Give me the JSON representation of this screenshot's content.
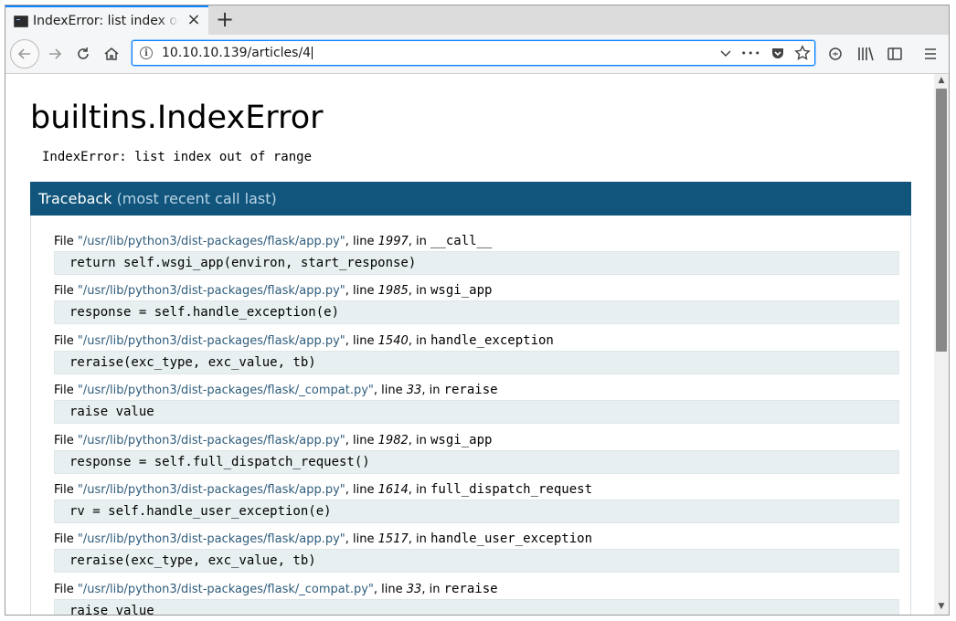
{
  "browser": {
    "tab_title": "IndexError: list index out of range",
    "new_tab_label": "+",
    "close_label": "×",
    "url": "10.10.10.139/articles/4",
    "url_info_label": "i",
    "more_label": "•••"
  },
  "page": {
    "error_heading": "builtins.IndexError",
    "error_message": "IndexError: list index out of range",
    "traceback_title": "Traceback",
    "traceback_subtitle": "(most recent call last)",
    "frames": [
      {
        "prefix": "File ",
        "file": "\"/usr/lib/python3/dist-packages/flask/app.py\"",
        "line_label": ", line ",
        "line": "1997",
        "in_label": ", in ",
        "func": "__call__",
        "code": "return self.wsgi_app(environ, start_response)"
      },
      {
        "prefix": "File ",
        "file": "\"/usr/lib/python3/dist-packages/flask/app.py\"",
        "line_label": ", line ",
        "line": "1985",
        "in_label": ", in ",
        "func": "wsgi_app",
        "code": "response = self.handle_exception(e)"
      },
      {
        "prefix": "File ",
        "file": "\"/usr/lib/python3/dist-packages/flask/app.py\"",
        "line_label": ", line ",
        "line": "1540",
        "in_label": ", in ",
        "func": "handle_exception",
        "code": "reraise(exc_type, exc_value, tb)"
      },
      {
        "prefix": "File ",
        "file": "\"/usr/lib/python3/dist-packages/flask/_compat.py\"",
        "line_label": ", line ",
        "line": "33",
        "in_label": ", in ",
        "func": "reraise",
        "code": "raise value"
      },
      {
        "prefix": "File ",
        "file": "\"/usr/lib/python3/dist-packages/flask/app.py\"",
        "line_label": ", line ",
        "line": "1982",
        "in_label": ", in ",
        "func": "wsgi_app",
        "code": "response = self.full_dispatch_request()"
      },
      {
        "prefix": "File ",
        "file": "\"/usr/lib/python3/dist-packages/flask/app.py\"",
        "line_label": ", line ",
        "line": "1614",
        "in_label": ", in ",
        "func": "full_dispatch_request",
        "code": "rv = self.handle_user_exception(e)"
      },
      {
        "prefix": "File ",
        "file": "\"/usr/lib/python3/dist-packages/flask/app.py\"",
        "line_label": ", line ",
        "line": "1517",
        "in_label": ", in ",
        "func": "handle_user_exception",
        "code": "reraise(exc_type, exc_value, tb)"
      },
      {
        "prefix": "File ",
        "file": "\"/usr/lib/python3/dist-packages/flask/_compat.py\"",
        "line_label": ", line ",
        "line": "33",
        "in_label": ", in ",
        "func": "reraise",
        "code": "raise value"
      }
    ]
  },
  "colors": {
    "traceback_header_bg": "#11557c",
    "code_bg": "#e8eff0",
    "file_link": "#2f5d7c",
    "focus_ring": "#0a84ff"
  }
}
